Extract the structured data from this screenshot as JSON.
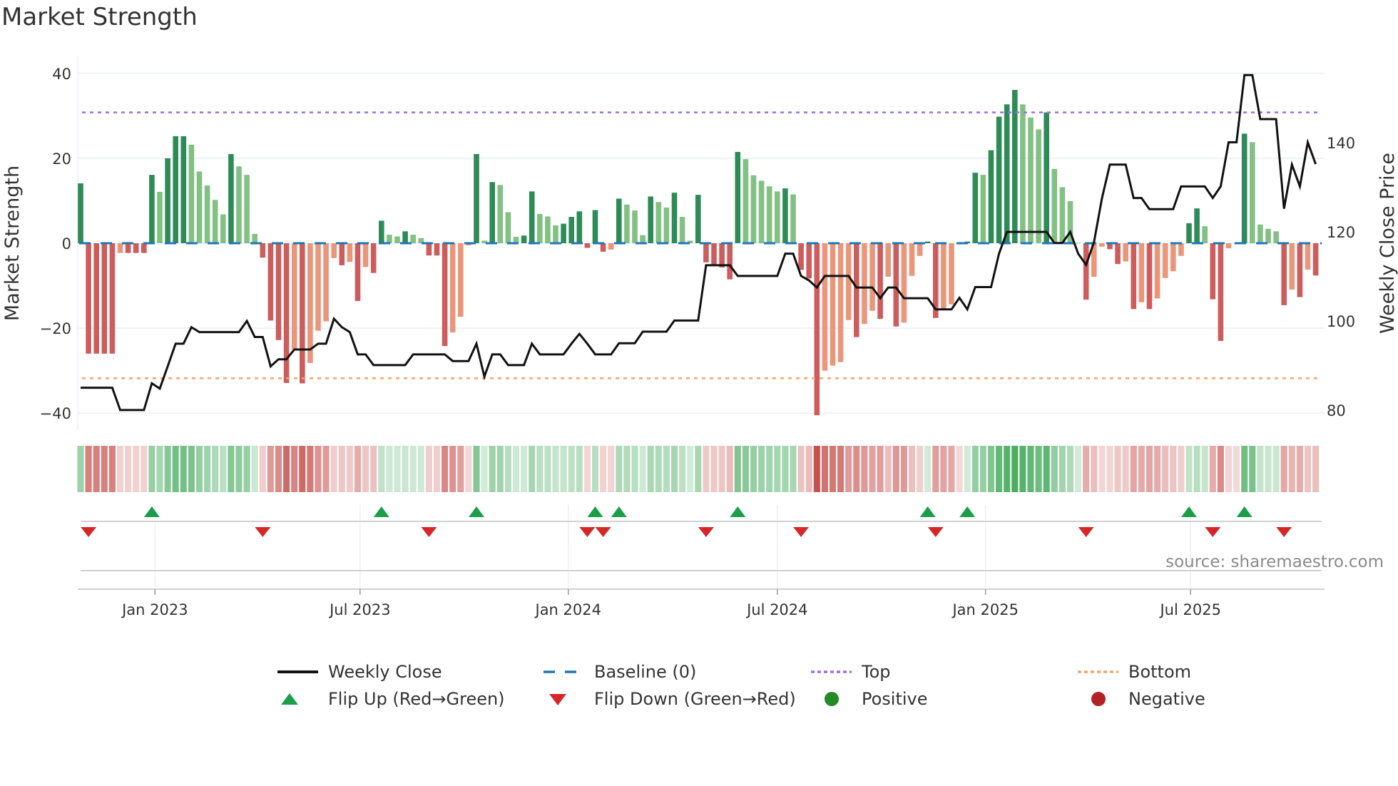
{
  "title": "Market Strength",
  "source_note": "source: sharemaestro.com",
  "colors": {
    "dark_green": "#2e8b57",
    "light_green": "#82c083",
    "red": "#cd5c5c",
    "light_red": "#e9967a",
    "top": "#9b6fe0",
    "bottom": "#f4a46a",
    "baseline": "#1f77b4",
    "flip_up": "#1a9e4a",
    "flip_down": "#d62728",
    "positive": "#228b22",
    "negative": "#b22222",
    "close": "#111111"
  },
  "legend": [
    {
      "label": "Weekly Close",
      "kind": "line"
    },
    {
      "label": "Baseline (0)",
      "kind": "dash"
    },
    {
      "label": "Top",
      "kind": "dot-top"
    },
    {
      "label": "Bottom",
      "kind": "dot-bottom"
    },
    {
      "label": "Flip Up (Red→Green)",
      "kind": "tri-up"
    },
    {
      "label": "Flip Down (Green→Red)",
      "kind": "tri-down"
    },
    {
      "label": "Positive",
      "kind": "circle-pos"
    },
    {
      "label": "Negative",
      "kind": "circle-neg"
    }
  ],
  "chart_data": {
    "type": "bar",
    "title": "Market Strength",
    "xlabel": "",
    "ylabel": "Market Strength",
    "y2label": "Weekly Close Price",
    "ylim": [
      -44,
      44
    ],
    "y2lim": [
      75.5,
      159.4
    ],
    "yticks": [
      40,
      20,
      0,
      -20,
      -40
    ],
    "ytick_labels": [
      "40",
      "20",
      "0",
      "−20",
      "−40"
    ],
    "y2ticks": [
      140,
      120,
      100,
      80
    ],
    "y2tick_labels": [
      "140",
      "120",
      "100",
      "80"
    ],
    "xticks": [
      {
        "week": 10.4,
        "label": "Jan 2023"
      },
      {
        "week": 36.3,
        "label": "Jul 2023"
      },
      {
        "week": 62.6,
        "label": "Jan 2024"
      },
      {
        "week": 89.0,
        "label": "Jul 2024"
      },
      {
        "week": 115.3,
        "label": "Jan 2025"
      },
      {
        "week": 141.2,
        "label": "Jul 2025"
      }
    ],
    "top_level": 30.8,
    "bottom_level": -31.8,
    "baseline": 0,
    "strength": [
      14.1,
      -26,
      -26,
      -26,
      -26,
      -2.3,
      -2.3,
      -2.3,
      -2.3,
      16.1,
      12.1,
      20,
      25.2,
      25.2,
      23.2,
      16.9,
      13.6,
      10.2,
      6.8,
      21,
      18.1,
      16.1,
      2.2,
      -3.4,
      -18.2,
      -22.8,
      -32.9,
      -25,
      -33,
      -28.2,
      -20.6,
      -18.4,
      -3.5,
      -5.2,
      -4.4,
      -13.6,
      -5.6,
      -7,
      5.3,
      2,
      1.6,
      2.8,
      2,
      1.2,
      -2.9,
      -2.9,
      -24.2,
      -21,
      -17.3,
      -0.5,
      21,
      0.6,
      14.4,
      13.7,
      7.3,
      1.5,
      1.8,
      12.2,
      6.9,
      6.3,
      4.2,
      4.6,
      6.2,
      7.5,
      -1.1,
      7.8,
      -2,
      -1.5,
      10.5,
      9.1,
      7.7,
      1.9,
      11,
      9.7,
      8.4,
      11.9,
      6.2,
      0.6,
      11.4,
      -4.5,
      -5,
      -5.7,
      -8.5,
      21.5,
      19.8,
      16,
      14.7,
      13.4,
      12.2,
      12.9,
      11.5,
      -6.3,
      -8.3,
      -40.5,
      -30,
      -28.8,
      -28,
      -18.1,
      -22.1,
      -19,
      -15.9,
      -17.8,
      -7.9,
      -19.6,
      -18.7,
      -7.7,
      -3,
      0.4,
      -17.6,
      -15.6,
      -14.4,
      -0.2,
      0.4,
      16.6,
      16.1,
      21.9,
      29.8,
      32.7,
      36.1,
      32.7,
      29.6,
      26.8,
      30.8,
      17.5,
      13.2,
      9.9,
      0.1,
      -13.3,
      -7.9,
      -0.8,
      -1.4,
      -4.9,
      -4.3,
      -15.5,
      -13.9,
      -15.5,
      -13,
      -8.2,
      -6.6,
      -3,
      4.7,
      8.2,
      4,
      -13.2,
      -23,
      -1.2,
      -0.1,
      25.8,
      23.8,
      4.4,
      3.4,
      2.8,
      -14.6,
      -10.9,
      -12.7,
      -6.2,
      -7.6
    ],
    "shade": [
      "G",
      "R",
      "R",
      "R",
      "R",
      "r",
      "R",
      "R",
      "R",
      "G",
      "g",
      "G",
      "G",
      "G",
      "g",
      "g",
      "g",
      "g",
      "g",
      "G",
      "g",
      "g",
      "g",
      "R",
      "R",
      "R",
      "R",
      "r",
      "R",
      "r",
      "r",
      "r",
      "r",
      "R",
      "r",
      "R",
      "r",
      "R",
      "G",
      "g",
      "g",
      "G",
      "g",
      "g",
      "R",
      "R",
      "R",
      "r",
      "r",
      "r",
      "G",
      "g",
      "G",
      "g",
      "g",
      "g",
      "G",
      "G",
      "g",
      "g",
      "g",
      "G",
      "G",
      "G",
      "R",
      "G",
      "R",
      "r",
      "G",
      "g",
      "g",
      "g",
      "G",
      "g",
      "g",
      "G",
      "g",
      "g",
      "G",
      "R",
      "R",
      "R",
      "R",
      "G",
      "g",
      "g",
      "g",
      "g",
      "g",
      "G",
      "g",
      "R",
      "R",
      "R",
      "r",
      "r",
      "r",
      "r",
      "R",
      "r",
      "r",
      "R",
      "r",
      "R",
      "r",
      "r",
      "r",
      "G",
      "R",
      "r",
      "r",
      "r",
      "G",
      "G",
      "g",
      "G",
      "G",
      "G",
      "G",
      "g",
      "g",
      "g",
      "G",
      "g",
      "g",
      "g",
      "g",
      "R",
      "r",
      "r",
      "R",
      "R",
      "r",
      "R",
      "r",
      "R",
      "r",
      "r",
      "r",
      "r",
      "G",
      "G",
      "g",
      "R",
      "R",
      "r",
      "r",
      "G",
      "g",
      "g",
      "g",
      "g",
      "R",
      "r",
      "R",
      "r",
      "R"
    ],
    "weekly_close": [
      85,
      85,
      85,
      85,
      85,
      80,
      80,
      80,
      80,
      86,
      84.8,
      89.8,
      94.9,
      94.9,
      98.6,
      97.5,
      97.5,
      97.5,
      97.5,
      97.5,
      97.5,
      100,
      96.4,
      96.4,
      89.8,
      91.4,
      91.4,
      93.6,
      93.6,
      93.6,
      94.9,
      94.9,
      100.5,
      98.6,
      97.5,
      92.5,
      92.5,
      90.1,
      90.1,
      90.1,
      90.1,
      90.1,
      92.5,
      92.5,
      92.5,
      92.5,
      92.5,
      91,
      91,
      91,
      94.9,
      87.5,
      92.5,
      92.5,
      90.1,
      90.1,
      90.1,
      94.9,
      92.5,
      92.5,
      92.5,
      92.5,
      94.9,
      97.1,
      94.9,
      92.5,
      92.5,
      92.5,
      95,
      95,
      95,
      97.6,
      97.6,
      97.6,
      97.6,
      100.1,
      100.1,
      100.1,
      100.1,
      112.5,
      112.5,
      112.5,
      112.5,
      110.1,
      110.1,
      110.1,
      110.1,
      110.1,
      110.1,
      115.1,
      115.1,
      110.1,
      109.1,
      107.5,
      110.1,
      110.1,
      110.1,
      110.1,
      107.5,
      107.5,
      107.5,
      105.1,
      107.5,
      107.5,
      105.1,
      105.1,
      105.1,
      105.1,
      102.6,
      102.6,
      102.6,
      105.2,
      102.6,
      107.6,
      107.6,
      107.6,
      115.1,
      120,
      120,
      120,
      120,
      120,
      120,
      117.5,
      117.5,
      120,
      115.1,
      112.6,
      117.7,
      127.5,
      135.1,
      135.1,
      135.1,
      127.6,
      127.6,
      125.1,
      125.1,
      125.1,
      125.1,
      130.2,
      130.2,
      130.2,
      130.2,
      127.6,
      130.2,
      140.1,
      140.1,
      155.2,
      155.2,
      145.3,
      145.3,
      145.3,
      125.2,
      135.1,
      130.2,
      140.1,
      135.2
    ],
    "flip_up_weeks": [
      10,
      39,
      51,
      66,
      69,
      84,
      108,
      113,
      141,
      148
    ],
    "flip_down_weeks": [
      2,
      24,
      45,
      65,
      67,
      80,
      92,
      109,
      128,
      144,
      153
    ]
  }
}
